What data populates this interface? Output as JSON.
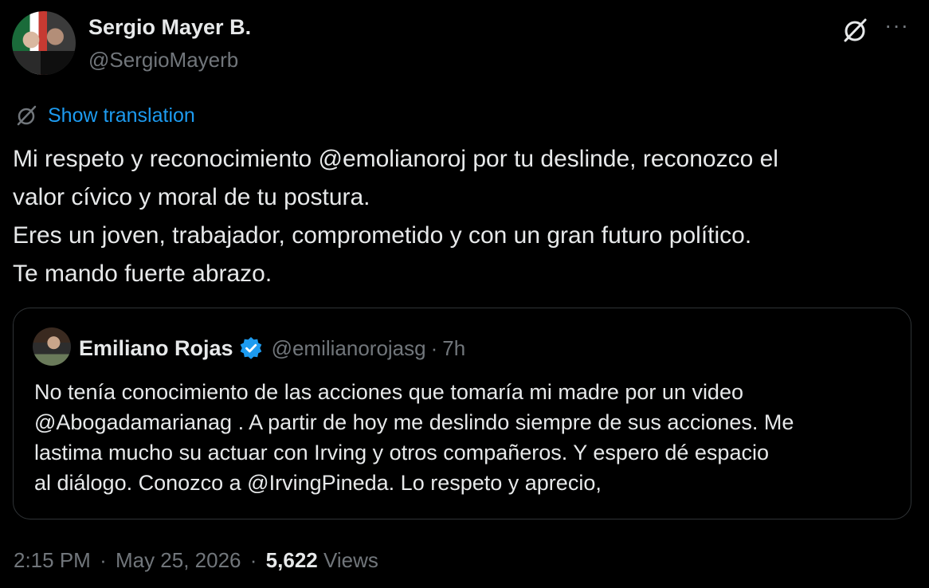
{
  "author": {
    "name": "Sergio Mayer B.",
    "handle": "@SergioMayerb"
  },
  "translate": {
    "label": "Show translation"
  },
  "tweet": {
    "lines": [
      "Mi respeto y reconocimiento @emolianoroj por tu deslinde, reconozco el",
      "valor cívico y moral de tu postura.",
      "Eres un joven, trabajador, comprometido y con un gran futuro político.",
      "Te mando fuerte abrazo."
    ]
  },
  "quote": {
    "name": "Emiliano Rojas",
    "handle": "@emilianorojasg",
    "separator": "·",
    "age": "7h",
    "lines": [
      "No tenía conocimiento de las acciones que tomaría mi madre por un video",
      "@Abogadamarianag . A partir de hoy me deslindo siempre de sus acciones. Me",
      "lastima mucho su actuar con Irving y otros compañeros. Y espero dé espacio",
      "al diálogo. Conozco a @IrvingPineda. Lo respeto y aprecio,"
    ]
  },
  "footer": {
    "time": "2:15 PM",
    "separator": "·",
    "date": "May 25, 2026",
    "views_count": "5,622",
    "views_label": "Views"
  },
  "icons": {
    "grok": "grok-icon",
    "more": "more-icon",
    "translate": "translate-icon",
    "verified": "verified-badge-icon"
  },
  "colors": {
    "background": "#000000",
    "text": "#e7e9ea",
    "muted": "#71767b",
    "accent": "#1d9bf0",
    "border": "#2f3336"
  }
}
